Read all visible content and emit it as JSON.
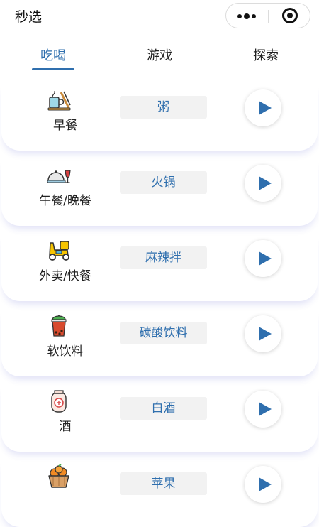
{
  "header": {
    "title": "秒选"
  },
  "capsule": {
    "more_icon": "more-dots-icon",
    "close_icon": "target-icon"
  },
  "tabs": [
    {
      "label": "吃喝",
      "active": true
    },
    {
      "label": "游戏",
      "active": false
    },
    {
      "label": "探索",
      "active": false
    }
  ],
  "items": [
    {
      "category": "早餐",
      "icon": "breakfast-icon",
      "pick": "粥"
    },
    {
      "category": "午餐/晚餐",
      "icon": "dining-icon",
      "pick": "火锅"
    },
    {
      "category": "外卖/快餐",
      "icon": "delivery-scooter-icon",
      "pick": "麻辣拌"
    },
    {
      "category": "软饮料",
      "icon": "bubble-tea-icon",
      "pick": "碳酸饮料"
    },
    {
      "category": "酒",
      "icon": "liquor-jar-icon",
      "pick": "白酒"
    },
    {
      "category": "",
      "icon": "fruit-basket-icon",
      "pick": "苹果"
    }
  ],
  "colors": {
    "accent": "#2f6fae",
    "pill_bg": "#f2f2f2"
  }
}
